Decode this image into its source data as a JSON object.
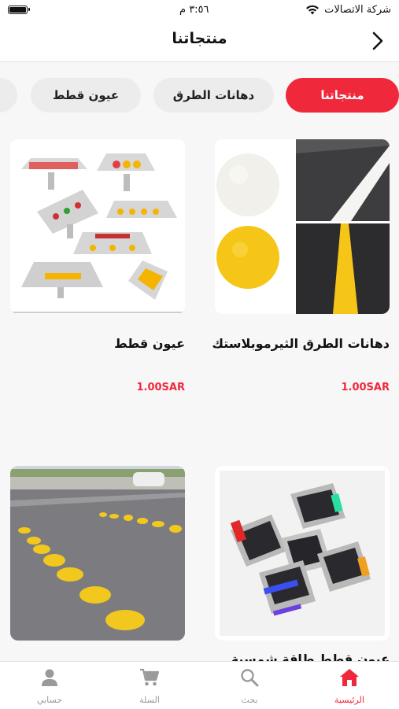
{
  "status_bar": {
    "carrier": "شركة الاتصالات",
    "time": "٣:٥٦ م"
  },
  "header": {
    "title": "منتجاتنا"
  },
  "categories": [
    {
      "label": "منتجاتنا",
      "active": true
    },
    {
      "label": "دهانات الطرق",
      "active": false
    },
    {
      "label": "عيون قطط",
      "active": false
    }
  ],
  "products": [
    {
      "name": "دهانات الطرق الثيرموبلاستك",
      "price": "1.00SAR"
    },
    {
      "name": "عيون قطط",
      "price": "1.00SAR"
    },
    {
      "name": "عيون قطط طاقة شمسية",
      "price": ""
    },
    {
      "name": "",
      "price": ""
    }
  ],
  "tabs": [
    {
      "label": "الرئيسية",
      "icon": "home-icon",
      "active": true
    },
    {
      "label": "بحث",
      "icon": "search-icon",
      "active": false
    },
    {
      "label": "السلة",
      "icon": "cart-icon",
      "active": false
    },
    {
      "label": "حسابي",
      "icon": "person-icon",
      "active": false
    }
  ],
  "colors": {
    "accent": "#f0283c",
    "chip_bg": "#ececec",
    "road_yellow": "#f5c518"
  }
}
